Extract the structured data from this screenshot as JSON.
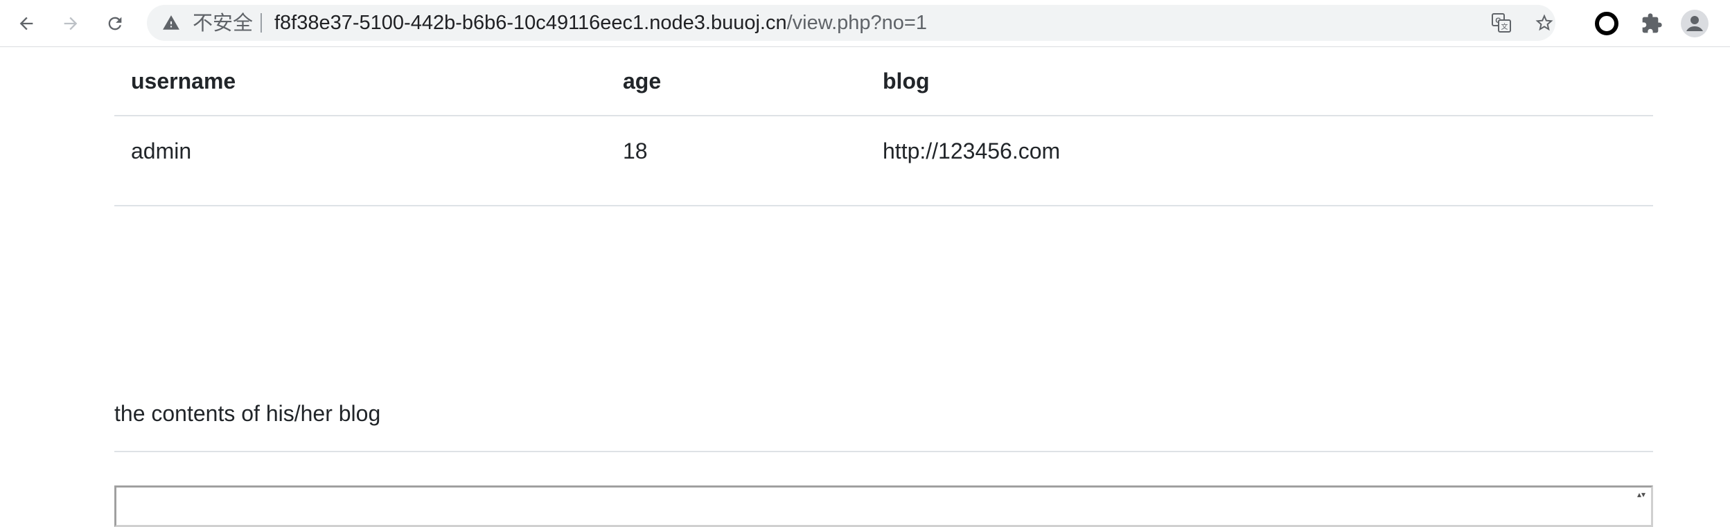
{
  "browser": {
    "security_label": "不安全",
    "url_host": "f8f38e37-5100-442b-b6b6-10c49116eec1.node3.buuoj.cn",
    "url_path": "/view.php?no=1",
    "icons": {
      "back": "back-arrow-icon",
      "forward": "forward-arrow-icon",
      "reload": "reload-icon",
      "warning": "warning-icon",
      "translate": "translate-icon",
      "bookmark": "star-icon",
      "extension_circle": "circle-extension-icon",
      "extensions": "puzzle-icon",
      "profile": "profile-icon"
    }
  },
  "table": {
    "headers": [
      "username",
      "age",
      "blog"
    ],
    "rows": [
      [
        "admin",
        "18",
        "http://123456.com"
      ]
    ]
  },
  "blog_section": {
    "heading": "the contents of his/her blog"
  },
  "colors": {
    "toolbar_bg": "#ffffff",
    "omnibox_bg": "#f1f3f4",
    "table_border": "#dee2e6",
    "text": "#212529"
  }
}
